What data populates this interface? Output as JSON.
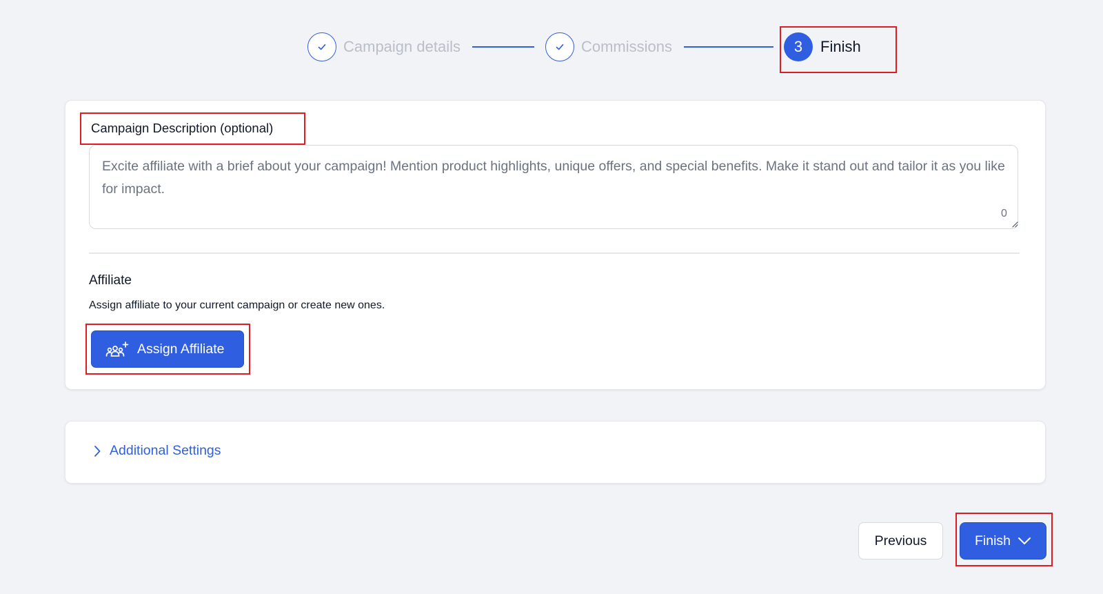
{
  "stepper": {
    "steps": [
      {
        "label": "Campaign details",
        "state": "done",
        "icon": "check-icon"
      },
      {
        "label": "Commissions",
        "state": "done",
        "icon": "check-icon"
      },
      {
        "label": "Finish",
        "state": "active",
        "number": "3"
      }
    ]
  },
  "description": {
    "label": "Campaign Description (optional)",
    "placeholder": "Excite affiliate with a brief about your campaign! Mention product highlights, unique offers, and special benefits. Make it stand out and tailor it as you like for impact.",
    "value": "",
    "char_count": "0"
  },
  "affiliate": {
    "title": "Affiliate",
    "description": "Assign affiliate to your current campaign or create new ones.",
    "assign_button": "Assign Affiliate",
    "assign_icon": "user-group-add-icon"
  },
  "additional_settings": {
    "label": "Additional Settings",
    "icon": "chevron-right-icon"
  },
  "footer": {
    "previous_label": "Previous",
    "finish_label": "Finish",
    "finish_icon": "chevron-down-icon"
  },
  "colors": {
    "primary": "#2f5fe0",
    "highlight": "#e01b24",
    "background": "#f2f3f7",
    "muted_text": "#b9bec8"
  }
}
